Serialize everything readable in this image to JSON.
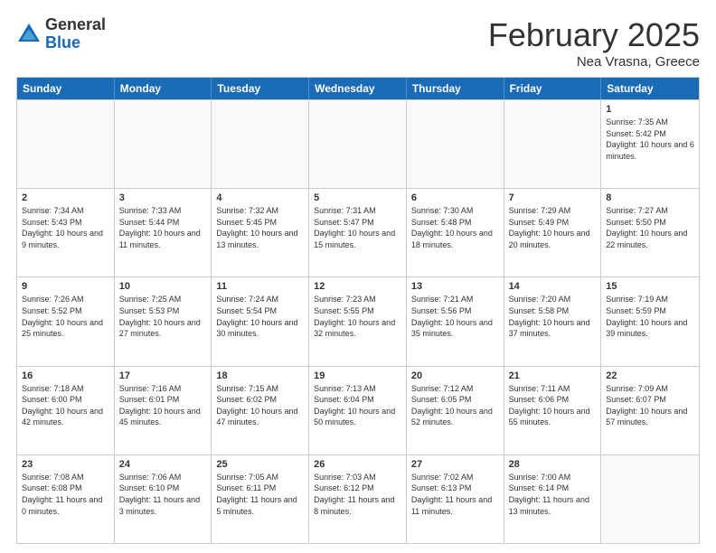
{
  "logo": {
    "general": "General",
    "blue": "Blue"
  },
  "header": {
    "title": "February 2025",
    "subtitle": "Nea Vrasna, Greece"
  },
  "weekdays": [
    "Sunday",
    "Monday",
    "Tuesday",
    "Wednesday",
    "Thursday",
    "Friday",
    "Saturday"
  ],
  "rows": [
    [
      {
        "day": "",
        "empty": true
      },
      {
        "day": "",
        "empty": true
      },
      {
        "day": "",
        "empty": true
      },
      {
        "day": "",
        "empty": true
      },
      {
        "day": "",
        "empty": true
      },
      {
        "day": "",
        "empty": true
      },
      {
        "day": "1",
        "sunrise": "Sunrise: 7:35 AM",
        "sunset": "Sunset: 5:42 PM",
        "daylight": "Daylight: 10 hours and 6 minutes."
      }
    ],
    [
      {
        "day": "2",
        "sunrise": "Sunrise: 7:34 AM",
        "sunset": "Sunset: 5:43 PM",
        "daylight": "Daylight: 10 hours and 9 minutes."
      },
      {
        "day": "3",
        "sunrise": "Sunrise: 7:33 AM",
        "sunset": "Sunset: 5:44 PM",
        "daylight": "Daylight: 10 hours and 11 minutes."
      },
      {
        "day": "4",
        "sunrise": "Sunrise: 7:32 AM",
        "sunset": "Sunset: 5:45 PM",
        "daylight": "Daylight: 10 hours and 13 minutes."
      },
      {
        "day": "5",
        "sunrise": "Sunrise: 7:31 AM",
        "sunset": "Sunset: 5:47 PM",
        "daylight": "Daylight: 10 hours and 15 minutes."
      },
      {
        "day": "6",
        "sunrise": "Sunrise: 7:30 AM",
        "sunset": "Sunset: 5:48 PM",
        "daylight": "Daylight: 10 hours and 18 minutes."
      },
      {
        "day": "7",
        "sunrise": "Sunrise: 7:29 AM",
        "sunset": "Sunset: 5:49 PM",
        "daylight": "Daylight: 10 hours and 20 minutes."
      },
      {
        "day": "8",
        "sunrise": "Sunrise: 7:27 AM",
        "sunset": "Sunset: 5:50 PM",
        "daylight": "Daylight: 10 hours and 22 minutes."
      }
    ],
    [
      {
        "day": "9",
        "sunrise": "Sunrise: 7:26 AM",
        "sunset": "Sunset: 5:52 PM",
        "daylight": "Daylight: 10 hours and 25 minutes."
      },
      {
        "day": "10",
        "sunrise": "Sunrise: 7:25 AM",
        "sunset": "Sunset: 5:53 PM",
        "daylight": "Daylight: 10 hours and 27 minutes."
      },
      {
        "day": "11",
        "sunrise": "Sunrise: 7:24 AM",
        "sunset": "Sunset: 5:54 PM",
        "daylight": "Daylight: 10 hours and 30 minutes."
      },
      {
        "day": "12",
        "sunrise": "Sunrise: 7:23 AM",
        "sunset": "Sunset: 5:55 PM",
        "daylight": "Daylight: 10 hours and 32 minutes."
      },
      {
        "day": "13",
        "sunrise": "Sunrise: 7:21 AM",
        "sunset": "Sunset: 5:56 PM",
        "daylight": "Daylight: 10 hours and 35 minutes."
      },
      {
        "day": "14",
        "sunrise": "Sunrise: 7:20 AM",
        "sunset": "Sunset: 5:58 PM",
        "daylight": "Daylight: 10 hours and 37 minutes."
      },
      {
        "day": "15",
        "sunrise": "Sunrise: 7:19 AM",
        "sunset": "Sunset: 5:59 PM",
        "daylight": "Daylight: 10 hours and 39 minutes."
      }
    ],
    [
      {
        "day": "16",
        "sunrise": "Sunrise: 7:18 AM",
        "sunset": "Sunset: 6:00 PM",
        "daylight": "Daylight: 10 hours and 42 minutes."
      },
      {
        "day": "17",
        "sunrise": "Sunrise: 7:16 AM",
        "sunset": "Sunset: 6:01 PM",
        "daylight": "Daylight: 10 hours and 45 minutes."
      },
      {
        "day": "18",
        "sunrise": "Sunrise: 7:15 AM",
        "sunset": "Sunset: 6:02 PM",
        "daylight": "Daylight: 10 hours and 47 minutes."
      },
      {
        "day": "19",
        "sunrise": "Sunrise: 7:13 AM",
        "sunset": "Sunset: 6:04 PM",
        "daylight": "Daylight: 10 hours and 50 minutes."
      },
      {
        "day": "20",
        "sunrise": "Sunrise: 7:12 AM",
        "sunset": "Sunset: 6:05 PM",
        "daylight": "Daylight: 10 hours and 52 minutes."
      },
      {
        "day": "21",
        "sunrise": "Sunrise: 7:11 AM",
        "sunset": "Sunset: 6:06 PM",
        "daylight": "Daylight: 10 hours and 55 minutes."
      },
      {
        "day": "22",
        "sunrise": "Sunrise: 7:09 AM",
        "sunset": "Sunset: 6:07 PM",
        "daylight": "Daylight: 10 hours and 57 minutes."
      }
    ],
    [
      {
        "day": "23",
        "sunrise": "Sunrise: 7:08 AM",
        "sunset": "Sunset: 6:08 PM",
        "daylight": "Daylight: 11 hours and 0 minutes."
      },
      {
        "day": "24",
        "sunrise": "Sunrise: 7:06 AM",
        "sunset": "Sunset: 6:10 PM",
        "daylight": "Daylight: 11 hours and 3 minutes."
      },
      {
        "day": "25",
        "sunrise": "Sunrise: 7:05 AM",
        "sunset": "Sunset: 6:11 PM",
        "daylight": "Daylight: 11 hours and 5 minutes."
      },
      {
        "day": "26",
        "sunrise": "Sunrise: 7:03 AM",
        "sunset": "Sunset: 6:12 PM",
        "daylight": "Daylight: 11 hours and 8 minutes."
      },
      {
        "day": "27",
        "sunrise": "Sunrise: 7:02 AM",
        "sunset": "Sunset: 6:13 PM",
        "daylight": "Daylight: 11 hours and 11 minutes."
      },
      {
        "day": "28",
        "sunrise": "Sunrise: 7:00 AM",
        "sunset": "Sunset: 6:14 PM",
        "daylight": "Daylight: 11 hours and 13 minutes."
      },
      {
        "day": "",
        "empty": true
      }
    ]
  ]
}
